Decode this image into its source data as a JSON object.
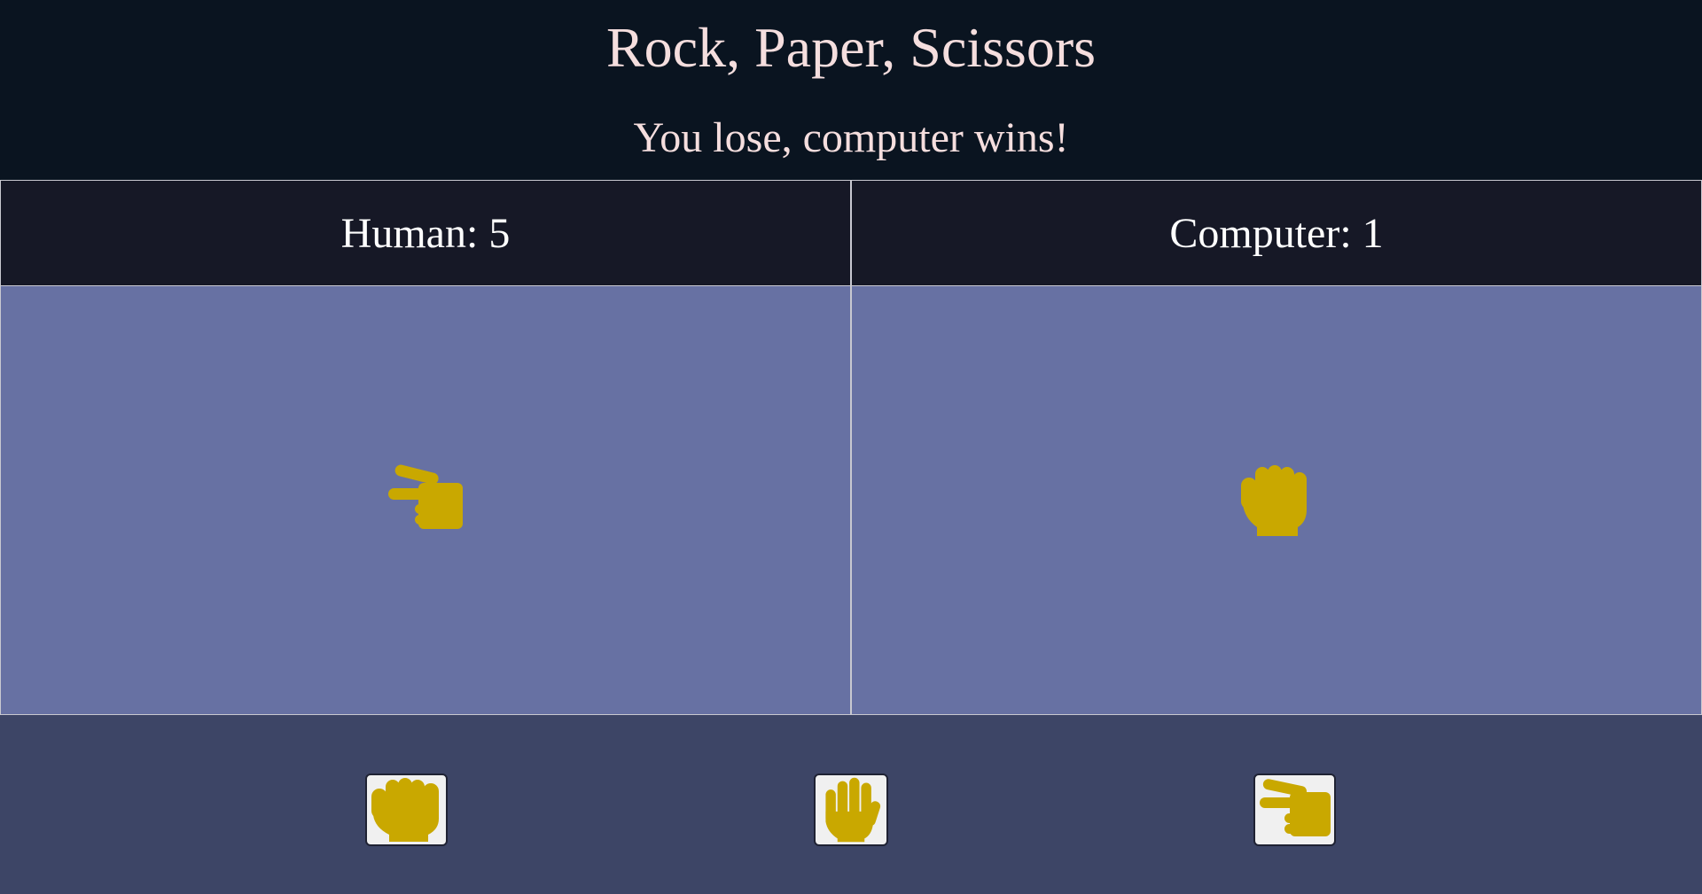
{
  "title": "Rock, Paper, Scissors",
  "result": "You lose, computer wins!",
  "human": {
    "label": "Human: 5",
    "choice_icon": "scissors-hand-icon"
  },
  "computer": {
    "label": "Computer: 1",
    "choice_icon": "rock-fist-icon"
  },
  "controls": [
    {
      "name": "rock",
      "icon": "rock-fist-icon"
    },
    {
      "name": "paper",
      "icon": "paper-hand-icon"
    },
    {
      "name": "scissors",
      "icon": "scissors-hand-icon"
    }
  ],
  "colors": {
    "header_bg": "#0a1420",
    "title_text": "#f5dede",
    "panel_head_bg": "#161826",
    "panel_bg": "#6771a3",
    "controls_bg": "#3d4566",
    "hand": "#c9a800",
    "button_bg": "#f0f0f0"
  }
}
